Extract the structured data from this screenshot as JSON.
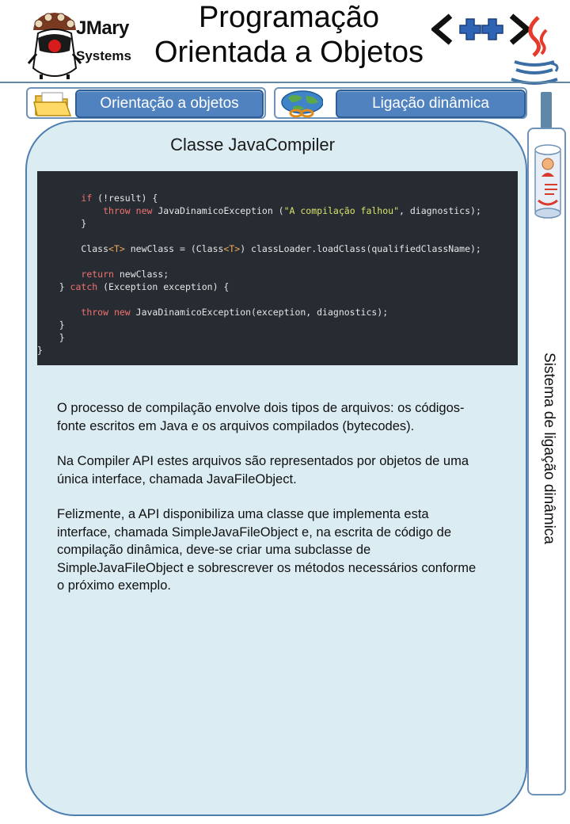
{
  "header": {
    "brand_name": "JMary",
    "brand_sub": "Systems",
    "title_line1": "Programação",
    "title_line2": "Orientada a Objetos",
    "cpp_logo_text": "<++>"
  },
  "tabs": [
    {
      "label": "Orientação a objetos",
      "icon": "folder-icon"
    },
    {
      "label": "Ligação dinâmica",
      "icon": "globe-link-icon"
    }
  ],
  "side_panel": {
    "label": "Sistema de ligação dinâmica",
    "icon": "document-scroll-icon"
  },
  "content": {
    "title": "Classe JavaCompiler",
    "code_lines": [
      [
        {
          "t": "        "
        },
        {
          "t": "if",
          "c": "kw"
        },
        {
          "t": " (!result) {"
        }
      ],
      [
        {
          "t": "            "
        },
        {
          "t": "throw",
          "c": "kw"
        },
        {
          "t": " "
        },
        {
          "t": "new",
          "c": "kw"
        },
        {
          "t": " JavaDinamicoException ("
        },
        {
          "t": "\"A compilação falhou\"",
          "c": "str"
        },
        {
          "t": ", diagnostics);"
        }
      ],
      [
        {
          "t": "        }"
        }
      ],
      [
        {
          "t": ""
        }
      ],
      [
        {
          "t": "        Class"
        },
        {
          "t": "<T>",
          "c": "gen"
        },
        {
          "t": " newClass = (Class"
        },
        {
          "t": "<T>",
          "c": "gen"
        },
        {
          "t": ") classLoader.loadClass(qualifiedClassName);"
        }
      ],
      [
        {
          "t": ""
        }
      ],
      [
        {
          "t": "        "
        },
        {
          "t": "return",
          "c": "kw"
        },
        {
          "t": " newClass;"
        }
      ],
      [
        {
          "t": "    } "
        },
        {
          "t": "catch",
          "c": "kw"
        },
        {
          "t": " (Exception exception) {"
        }
      ],
      [
        {
          "t": ""
        }
      ],
      [
        {
          "t": "        "
        },
        {
          "t": "throw",
          "c": "kw"
        },
        {
          "t": " "
        },
        {
          "t": "new",
          "c": "kw"
        },
        {
          "t": " JavaDinamicoException(exception, diagnostics);"
        }
      ],
      [
        {
          "t": "    }"
        }
      ],
      [
        {
          "t": "    }"
        }
      ],
      [
        {
          "t": "}"
        }
      ]
    ],
    "paragraphs": [
      "O processo de compilação envolve dois tipos de arquivos: os códigos-fonte escritos em Java e os arquivos compilados (bytecodes).",
      "Na Compiler API estes arquivos são representados por objetos de uma única interface, chamada JavaFileObject.",
      "Felizmente, a API disponibiliza uma classe que implementa esta interface, chamada SimpleJavaFileObject e, na escrita de código de compilação dinâmica, deve-se criar uma subclasse de SimpleJavaFileObject e sobrescrever os métodos necessários conforme o próximo exemplo."
    ]
  },
  "colors": {
    "accent": "#4f82bf",
    "card_bg": "#dbecf3",
    "code_bg": "#272c32",
    "keyword": "#f0716f",
    "string": "#d9e26b",
    "generic": "#f0a75a"
  }
}
